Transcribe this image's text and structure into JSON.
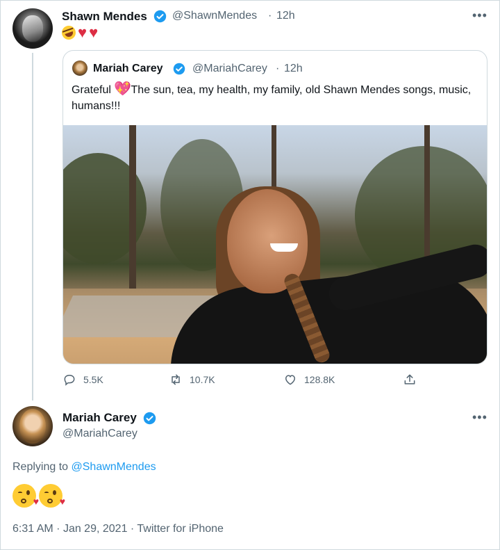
{
  "tweet": {
    "author_name": "Shawn Mendes",
    "author_handle": "@ShawnMendes",
    "sep": "·",
    "time_ago": "12h",
    "more": "•••",
    "emojis": [
      "rolling-on-floor-laughing",
      "red-heart",
      "red-heart"
    ]
  },
  "quoted": {
    "author_name": "Mariah Carey",
    "author_handle": "@MariahCarey",
    "sep": "·",
    "time_ago": "12h",
    "text_before": "Grateful",
    "text_after": " The sun, tea, my health, my family, old Shawn Mendes songs, music, humans!!!",
    "emoji": "sparkling-heart",
    "photo": "selfie-outdoors-sunny-woods"
  },
  "actions": {
    "replies": "5.5K",
    "retweets": "10.7K",
    "likes": "128.8K"
  },
  "reply": {
    "author_name": "Mariah Carey",
    "author_handle": "@MariahCarey",
    "more": "•••",
    "replying_prefix": "Replying to ",
    "replying_to": "@ShawnMendes",
    "emojis": [
      "face-blowing-a-kiss",
      "face-blowing-a-kiss"
    ],
    "time": "6:31 AM",
    "date": "Jan 29, 2021",
    "source": "Twitter for iPhone",
    "sep": "·"
  },
  "colors": {
    "verified": "#1d9bf0",
    "link": "#1d9bf0",
    "muted": "#536471",
    "heart": "#dd2e44"
  }
}
